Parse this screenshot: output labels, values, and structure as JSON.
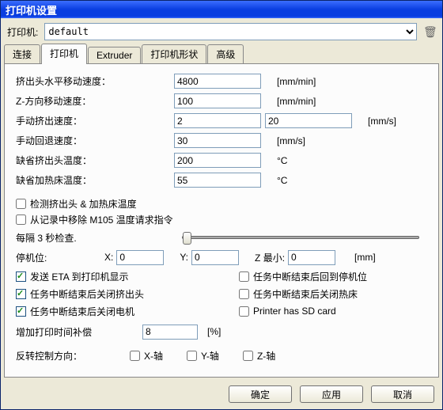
{
  "window": {
    "title": "打印机设置"
  },
  "printerRow": {
    "label": "打印机:",
    "selected": "default"
  },
  "tabs": {
    "t0": "连接",
    "t1": "打印机",
    "t2": "Extruder",
    "t3": "打印机形状",
    "t4": "高级"
  },
  "fields": {
    "travel": {
      "label": "挤出头水平移动速度：",
      "value": "4800",
      "unit": "[mm/min]"
    },
    "zfeed": {
      "label": "Z-方向移动速度：",
      "value": "100",
      "unit": "[mm/min]"
    },
    "manext": {
      "label": "手动挤出速度：",
      "value1": "2",
      "value2": "20",
      "unit": "[mm/s]"
    },
    "manret": {
      "label": "手动回退速度：",
      "value": "30",
      "unit": "[mm/s]"
    },
    "extemp": {
      "label": "缺省挤出头温度：",
      "value": "200",
      "unit": "°C"
    },
    "bedtemp": {
      "label": "缺省加热床温度：",
      "value": "55",
      "unit": "°C"
    }
  },
  "checks": {
    "c1": "检测挤出头 & 加热床温度",
    "c2": "从记录中移除 M105 温度请求指令",
    "interval": "每隔 3 秒检查.",
    "eta": "发送 ETA 到打印机显示",
    "park": "任务中断结束后回到停机位",
    "extoff": "任务中断结束后关闭挤出头",
    "bedoff": "任务中断结束后关闭热床",
    "motoff": "任务中断结束后关闭电机",
    "sd": "Printer has SD card"
  },
  "park": {
    "label": "停机位:",
    "xl": "X:",
    "xv": "0",
    "yl": "Y:",
    "yv": "0",
    "zl": "Z 最小:",
    "zv": "0",
    "unit": "[mm]"
  },
  "perc": {
    "label": "增加打印时间补偿",
    "value": "8",
    "unit": "[%]"
  },
  "axis": {
    "label": "反转控制方向：",
    "x": "X-轴",
    "y": "Y-轴",
    "z": "Z-轴"
  },
  "buttons": {
    "ok": "确定",
    "apply": "应用",
    "cancel": "取消"
  }
}
